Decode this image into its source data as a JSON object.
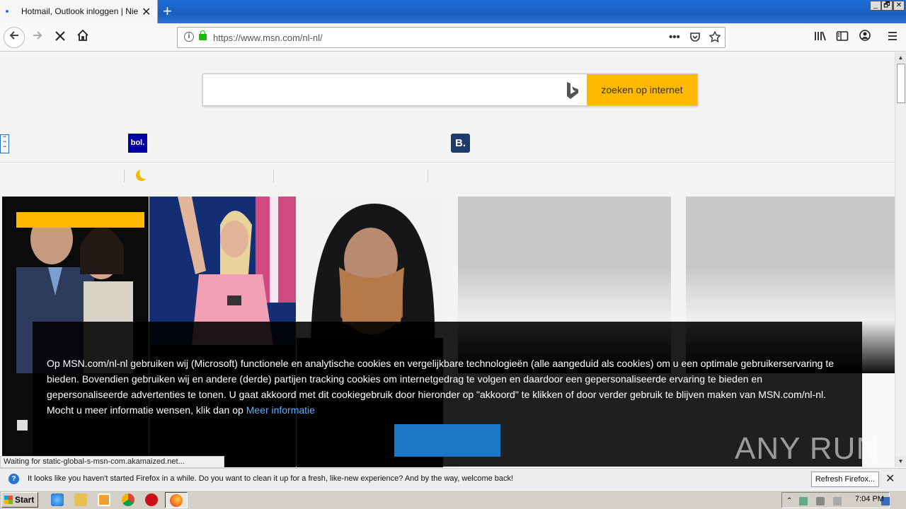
{
  "browser": {
    "tab_title": "Hotmail, Outlook inloggen | Nieuws",
    "url": "https://www.msn.com/nl-nl/",
    "new_tab": "+",
    "close_tab": "✕",
    "status_text": "Waiting for static-global-s-msn-com.akamaized.net..."
  },
  "window_controls": [
    "_",
    "🗗",
    "✕"
  ],
  "search": {
    "button_label": "zoeken op internet",
    "placeholder": ""
  },
  "quick_links": {
    "bol": "bol.",
    "booking": "B."
  },
  "cookie_banner": {
    "text": "Op MSN.com/nl-nl gebruiken wij (Microsoft) functionele en analytische cookies en vergelijkbare technologieën (alle aangeduid als cookies) om u een optimale gebruikerservaring te bieden. Bovendien gebruiken wij en andere (derde) partijen tracking cookies om internetgedrag te volgen en daardoor een gepersonaliseerde ervaring te bieden en gepersonaliseerde advertenties te tonen. U gaat akkoord met dit cookiegebruik door hieronder op \"akkoord\" te klikken of door verder gebruik te blijven maken van MSN.com/nl-nl. Mocht u meer informatie wensen, klik dan op ",
    "link": "Meer informatie"
  },
  "watermark": "ANY RUN",
  "notification": {
    "text": "It looks like you haven't started Firefox in a while. Do you want to clean it up for a fresh, like-new experience? And by the way, welcome back!",
    "button": "Refresh Firefox...",
    "close": "✕"
  },
  "taskbar": {
    "start": "Start",
    "clock": "7:04 PM"
  },
  "colors": {
    "search_button": "#ffb900",
    "cookie_button": "#1b78c8",
    "link": "#5fb0ff",
    "ssl_lock": "#12bc00"
  }
}
